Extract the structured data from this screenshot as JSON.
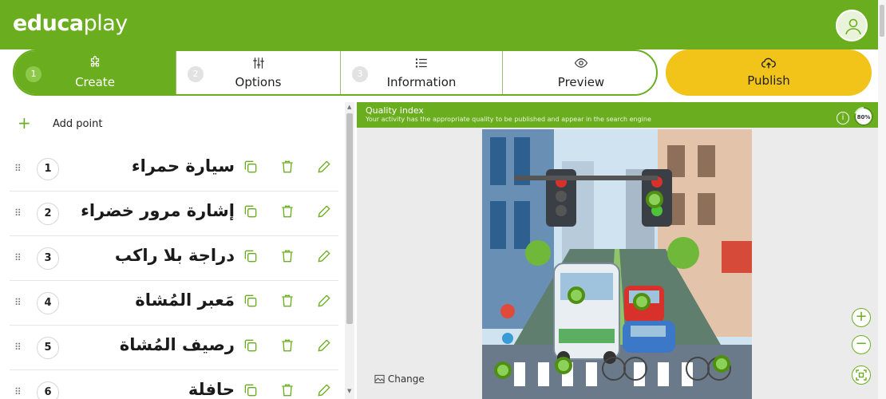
{
  "header": {
    "logo_bold": "educa",
    "logo_light": "play"
  },
  "steps": [
    {
      "num": "1",
      "icon": "puzzle-icon",
      "label": "Create",
      "active": true
    },
    {
      "num": "2",
      "icon": "sliders-icon",
      "label": "Options",
      "active": false
    },
    {
      "num": "3",
      "icon": "list-icon",
      "label": "Information",
      "active": false
    },
    {
      "num": "",
      "icon": "eye-icon",
      "label": "Preview",
      "active": false
    }
  ],
  "publish": {
    "icon": "cloud-upload-icon",
    "label": "Publish"
  },
  "add_point": {
    "label": "Add point"
  },
  "points": [
    {
      "num": "1",
      "name": "سيارة حمراء"
    },
    {
      "num": "2",
      "name": "إشارة مرور خضراء"
    },
    {
      "num": "3",
      "name": "دراجة بلا راكب"
    },
    {
      "num": "4",
      "name": "مَعبر المُشاة"
    },
    {
      "num": "5",
      "name": "رصيف المُشاة"
    },
    {
      "num": "6",
      "name": "حافلة"
    }
  ],
  "quality": {
    "title": "Quality index",
    "subtitle": "Your activity has the appropriate quality to be published and appear in the search engine",
    "info": "i",
    "percent_label": "80%",
    "percent_value": 80
  },
  "change": {
    "label": "Change"
  },
  "zoom": {
    "in": "+",
    "out": "−"
  },
  "colors": {
    "brand_green": "#6aae1f",
    "publish_yellow": "#f2c318"
  }
}
